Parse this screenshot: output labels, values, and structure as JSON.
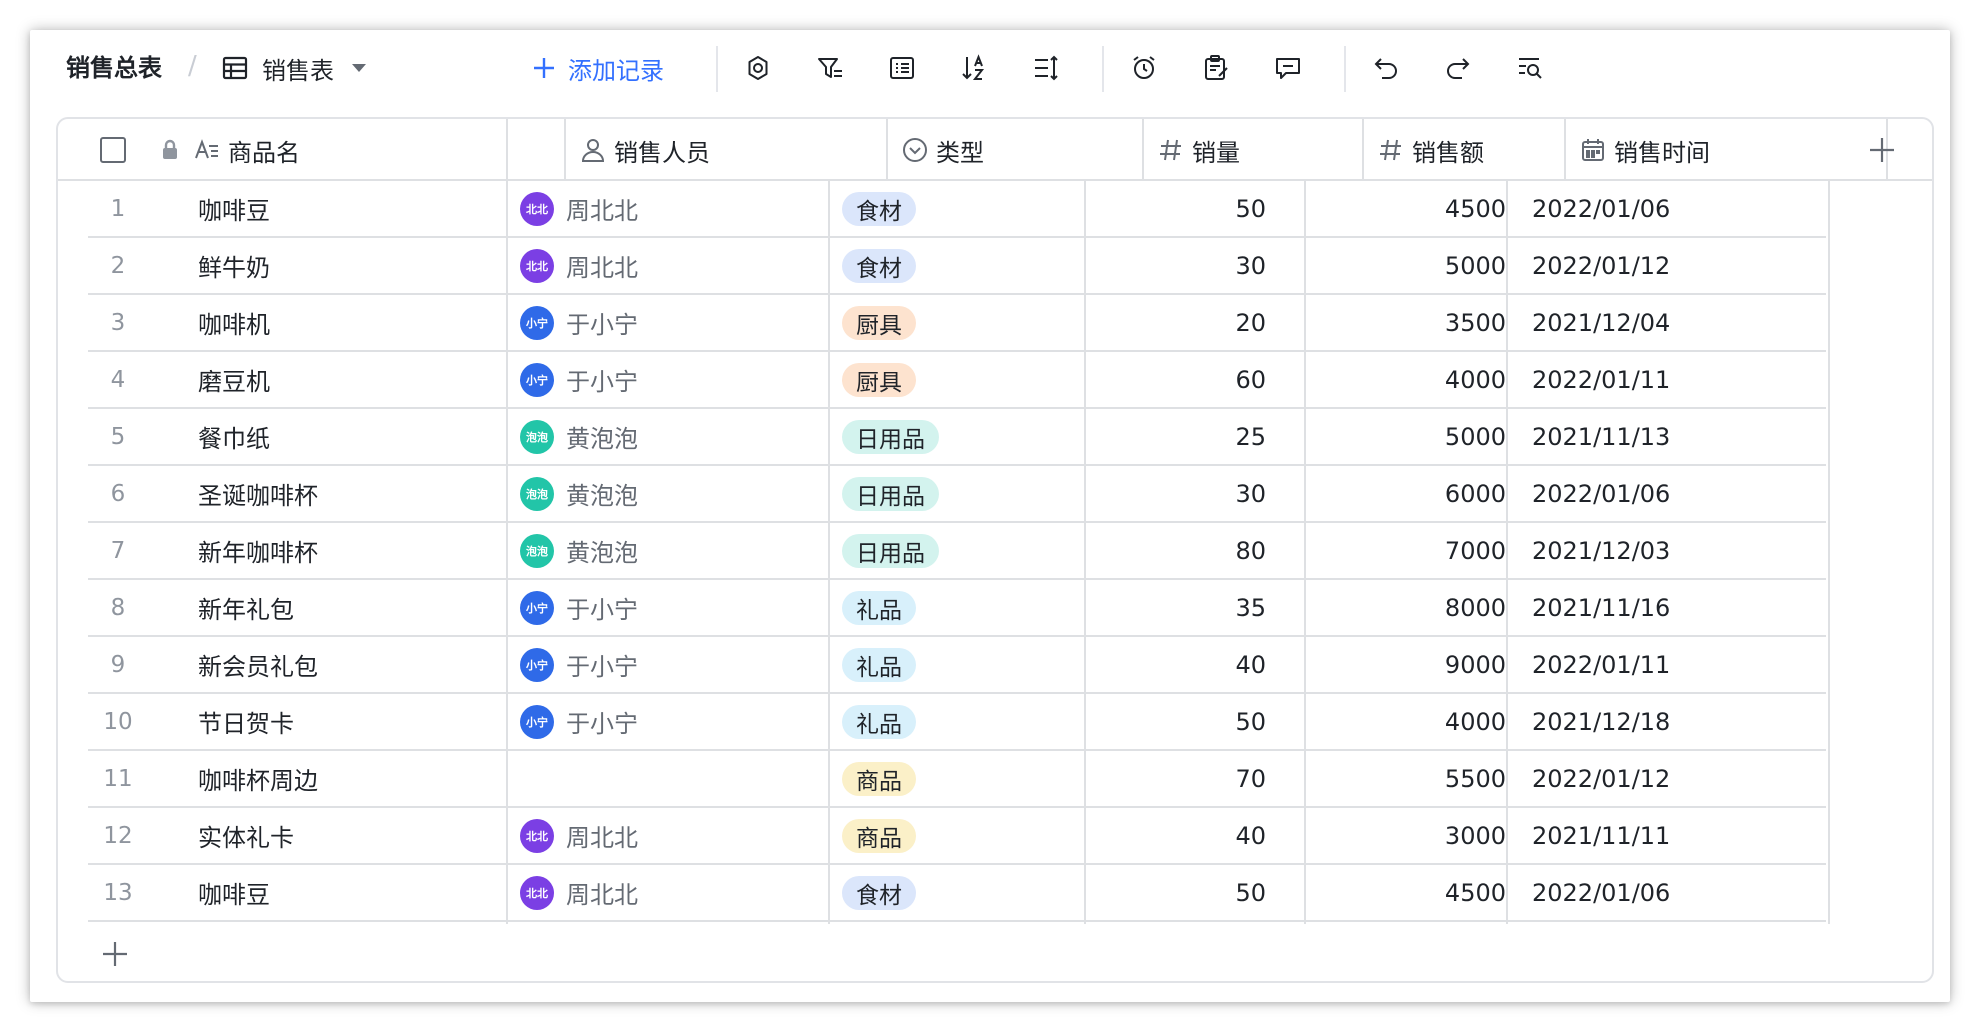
{
  "toolbar": {
    "breadcrumb_root": "销售总表",
    "breadcrumb_sep": "/",
    "view_name": "销售表",
    "add_record": "添加记录"
  },
  "columns": [
    {
      "label": "商品名",
      "icon": "text-field-icon"
    },
    {
      "label": "销售人员",
      "icon": "person-field-icon"
    },
    {
      "label": "类型",
      "icon": "single-select-icon"
    },
    {
      "label": "销量",
      "icon": "number-field-icon"
    },
    {
      "label": "销售额",
      "icon": "number-field-icon"
    },
    {
      "label": "销售时间",
      "icon": "date-field-icon"
    }
  ],
  "colors": {
    "accent": "#3370ff",
    "avatar_zhou": "#7b3fe4",
    "avatar_yu": "#2f6ae8",
    "avatar_huang": "#22c5a8",
    "tag_food": "#dbe6fb",
    "tag_kitchen": "#fde3cf",
    "tag_daily": "#d3f3ee",
    "tag_gift": "#d8f0fb",
    "tag_goods": "#fbf0c8"
  },
  "rows": [
    {
      "idx": "1",
      "name": "咖啡豆",
      "person": "周北北",
      "avatar": "北北",
      "type": "食材",
      "qty": "50",
      "amount": "4500",
      "date": "2022/01/06"
    },
    {
      "idx": "2",
      "name": "鲜牛奶",
      "person": "周北北",
      "avatar": "北北",
      "type": "食材",
      "qty": "30",
      "amount": "5000",
      "date": "2022/01/12"
    },
    {
      "idx": "3",
      "name": "咖啡机",
      "person": "于小宁",
      "avatar": "小宁",
      "type": "厨具",
      "qty": "20",
      "amount": "3500",
      "date": "2021/12/04"
    },
    {
      "idx": "4",
      "name": "磨豆机",
      "person": "于小宁",
      "avatar": "小宁",
      "type": "厨具",
      "qty": "60",
      "amount": "4000",
      "date": "2022/01/11"
    },
    {
      "idx": "5",
      "name": "餐巾纸",
      "person": "黄泡泡",
      "avatar": "泡泡",
      "type": "日用品",
      "qty": "25",
      "amount": "5000",
      "date": "2021/11/13"
    },
    {
      "idx": "6",
      "name": "圣诞咖啡杯",
      "person": "黄泡泡",
      "avatar": "泡泡",
      "type": "日用品",
      "qty": "30",
      "amount": "6000",
      "date": "2022/01/06"
    },
    {
      "idx": "7",
      "name": "新年咖啡杯",
      "person": "黄泡泡",
      "avatar": "泡泡",
      "type": "日用品",
      "qty": "80",
      "amount": "7000",
      "date": "2021/12/03"
    },
    {
      "idx": "8",
      "name": "新年礼包",
      "person": "于小宁",
      "avatar": "小宁",
      "type": "礼品",
      "qty": "35",
      "amount": "8000",
      "date": "2021/11/16"
    },
    {
      "idx": "9",
      "name": "新会员礼包",
      "person": "于小宁",
      "avatar": "小宁",
      "type": "礼品",
      "qty": "40",
      "amount": "9000",
      "date": "2022/01/11"
    },
    {
      "idx": "10",
      "name": "节日贺卡",
      "person": "于小宁",
      "avatar": "小宁",
      "type": "礼品",
      "qty": "50",
      "amount": "4000",
      "date": "2021/12/18"
    },
    {
      "idx": "11",
      "name": "咖啡杯周边",
      "person": "",
      "avatar": "",
      "type": "商品",
      "qty": "70",
      "amount": "5500",
      "date": "2022/01/12"
    },
    {
      "idx": "12",
      "name": "实体礼卡",
      "person": "周北北",
      "avatar": "北北",
      "type": "商品",
      "qty": "40",
      "amount": "3000",
      "date": "2021/11/11"
    },
    {
      "idx": "13",
      "name": "咖啡豆",
      "person": "周北北",
      "avatar": "北北",
      "type": "食材",
      "qty": "50",
      "amount": "4500",
      "date": "2022/01/06"
    }
  ]
}
